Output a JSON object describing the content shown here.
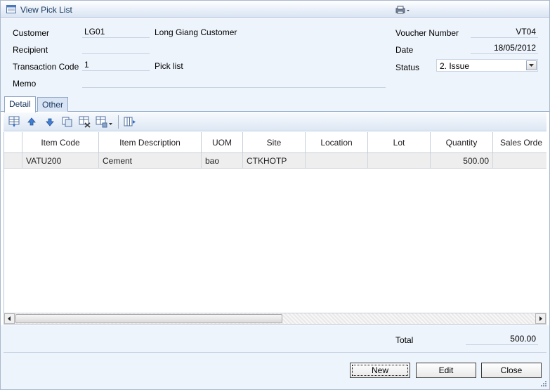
{
  "window": {
    "title": "View Pick List"
  },
  "header": {
    "customer_label": "Customer",
    "customer_code": "LG01",
    "customer_name": "Long Giang Customer",
    "recipient_label": "Recipient",
    "recipient_value": "",
    "transaction_code_label": "Transaction Code",
    "transaction_code": "1",
    "transaction_name": "Pick list",
    "memo_label": "Memo",
    "memo_value": "",
    "voucher_number_label": "Voucher Number",
    "voucher_number": "VT04",
    "date_label": "Date",
    "date": "18/05/2012",
    "status_label": "Status",
    "status_value": "2. Issue"
  },
  "tabs": [
    {
      "label": "Detail",
      "active": true
    },
    {
      "label": "Other",
      "active": false
    }
  ],
  "grid": {
    "columns": [
      "Item Code",
      "Item Description",
      "UOM",
      "Site",
      "Location",
      "Lot",
      "Quantity",
      "Sales Orde"
    ],
    "rows": [
      [
        "VATU200",
        "Cement",
        "bao",
        "CTKHOTP",
        "",
        "",
        "500.00",
        ""
      ]
    ]
  },
  "footer": {
    "total_label": "Total",
    "total_value": "500.00",
    "new_label": "New",
    "edit_label": "Edit",
    "close_label": "Close"
  },
  "icons": {
    "app": "list-window-icon",
    "print": "printer-dropdown-icon",
    "toolbar": [
      "insert-row-icon",
      "move-up-icon",
      "move-down-icon",
      "copy-row-icon",
      "delete-row-icon",
      "more-rows-dropdown-icon",
      "column-chooser-icon"
    ]
  },
  "colors": {
    "panel": "#eef4fc",
    "border": "#a9b8cf",
    "title_text": "#15365e",
    "row_fill": "#eeeeee"
  }
}
